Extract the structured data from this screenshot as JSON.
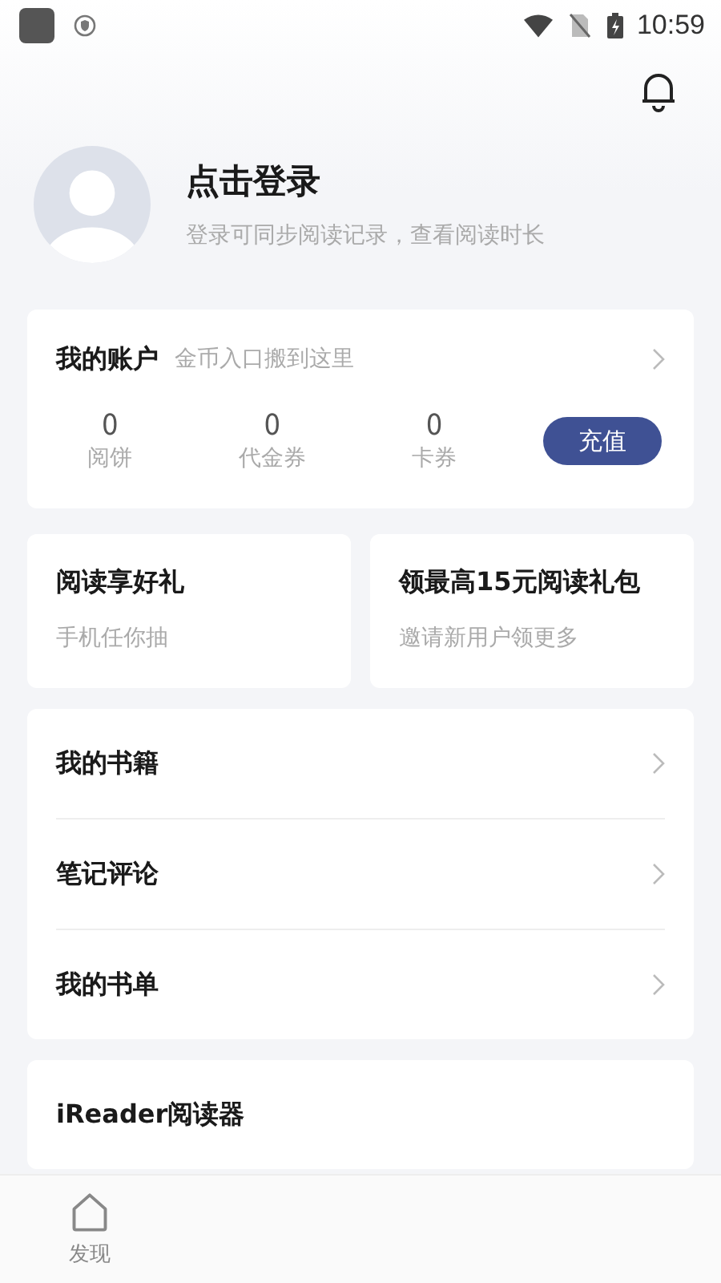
{
  "status_bar": {
    "time": "10:59"
  },
  "profile": {
    "title": "点击登录",
    "subtitle": "登录可同步阅读记录，查看阅读时长"
  },
  "account": {
    "title": "我的账户",
    "hint": "金币入口搬到这里",
    "stats": [
      {
        "value": "0",
        "label": "阅饼"
      },
      {
        "value": "0",
        "label": "代金券"
      },
      {
        "value": "0",
        "label": "卡券"
      }
    ],
    "button": "充值"
  },
  "promos": [
    {
      "title": "阅读享好礼",
      "subtitle": "手机任你抽"
    },
    {
      "title": "领最高15元阅读礼包",
      "subtitle": "邀请新用户领更多"
    }
  ],
  "menu": [
    {
      "label": "我的书籍"
    },
    {
      "label": "笔记评论"
    },
    {
      "label": "我的书单"
    }
  ],
  "partial_row": {
    "label": "iReader阅读器"
  },
  "tab_bar": [
    {
      "label": "发现",
      "selected": false
    }
  ]
}
